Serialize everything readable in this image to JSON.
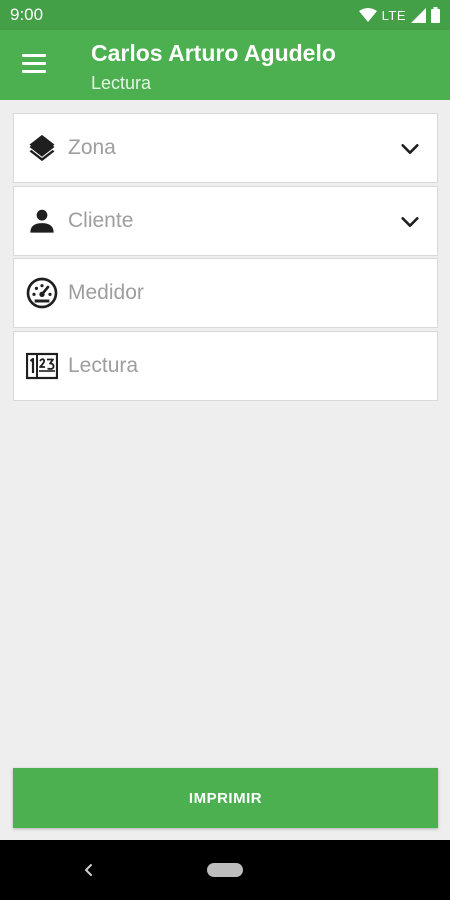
{
  "status_bar": {
    "time": "9:00",
    "network": "LTE",
    "icons": [
      "wifi-icon",
      "signal-icon",
      "battery-icon"
    ]
  },
  "app_bar": {
    "title": "Carlos Arturo Agudelo",
    "subtitle": "Lectura",
    "menu_icon": "hamburger-menu-icon"
  },
  "form": {
    "zona": {
      "placeholder": "Zona",
      "icon": "layers-icon",
      "dropdown": true
    },
    "cliente": {
      "placeholder": "Cliente",
      "icon": "person-icon",
      "dropdown": true
    },
    "medidor": {
      "placeholder": "Medidor",
      "icon": "speedometer-icon"
    },
    "lectura": {
      "placeholder": "Lectura",
      "icon": "numeric-icon"
    }
  },
  "actions": {
    "print_label": "IMPRIMIR"
  },
  "colors": {
    "primary": "#4caf50",
    "primary_dark": "#43a047",
    "background": "#eeeeee",
    "placeholder": "#9e9e9e"
  }
}
